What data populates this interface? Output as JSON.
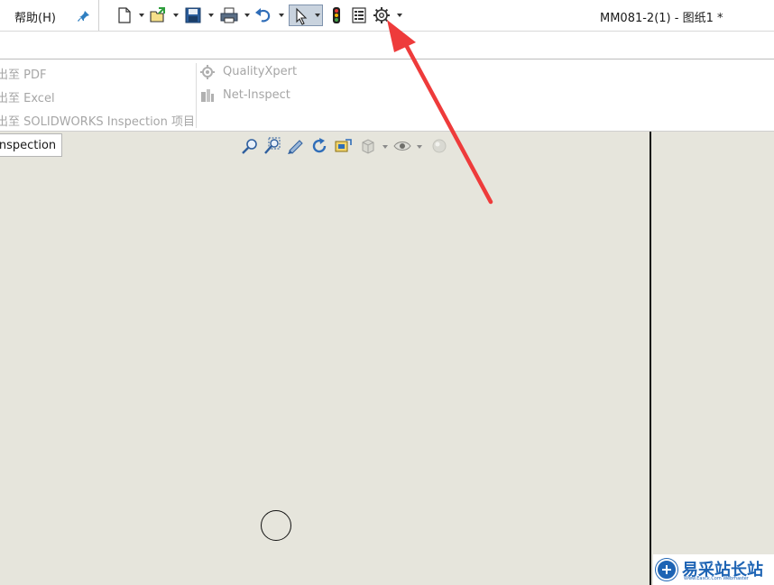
{
  "menu": {
    "help_label": "帮助(H)"
  },
  "window": {
    "doc_title": "MM081-2(1) - 图纸1 *"
  },
  "toolbar": {
    "icons": [
      "new-document-icon",
      "open-icon",
      "save-icon",
      "print-icon",
      "undo-icon",
      "select-icon",
      "rebuild-icon",
      "file-properties-icon",
      "options-gear-icon"
    ]
  },
  "ribbon": {
    "left_items": [
      "出至 PDF",
      "出至 Excel",
      "出至 SOLIDWORKS Inspection 项目"
    ],
    "right_items": [
      "QualityXpert",
      "Net-Inspect"
    ]
  },
  "tabs": {
    "active": "Inspection"
  },
  "colors": {
    "canvas_bg": "#e6e5dc",
    "annotation_arrow": "#ee3b3b",
    "watermark_blue": "#1e64b4",
    "selected_tool_bg": "#c9d3de"
  },
  "watermark": {
    "text": "易采站长站",
    "subtext": "Www.Easck.Com  Webmaster"
  }
}
